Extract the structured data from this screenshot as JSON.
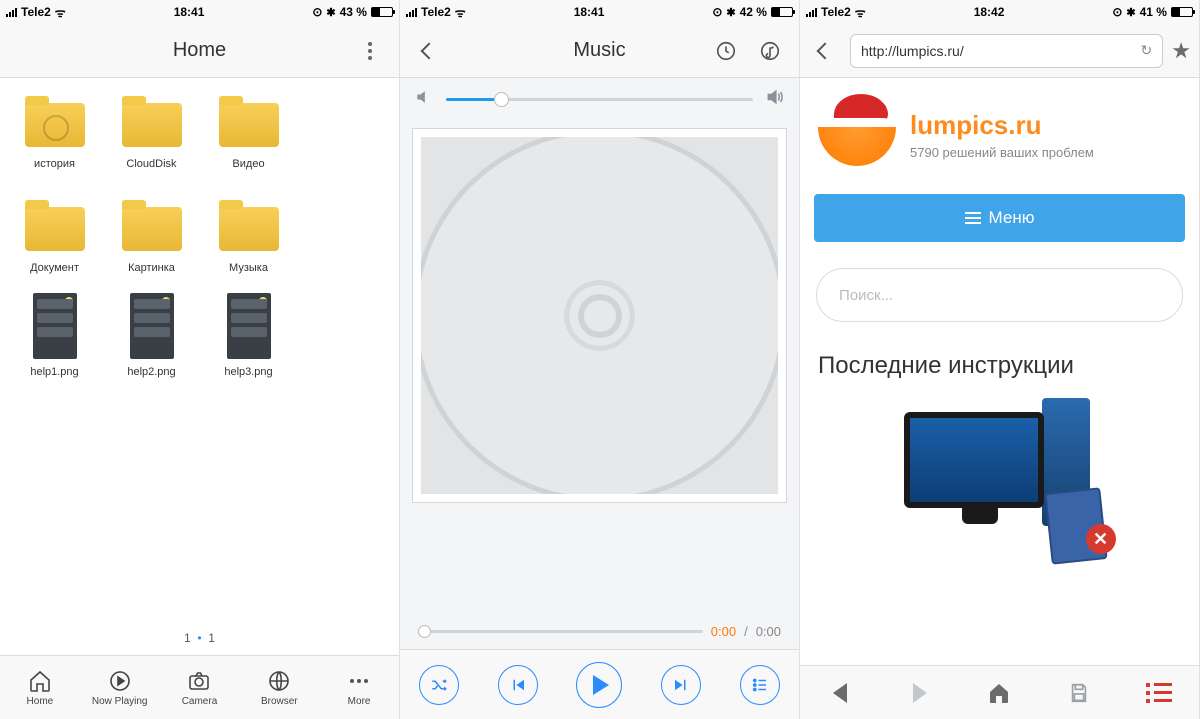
{
  "status": {
    "carrier": "Tele2",
    "s1_time": "18:41",
    "s2_time": "18:41",
    "s3_time": "18:42",
    "s1_batt": "43 %",
    "s2_batt": "42 %",
    "s3_batt": "41 %",
    "alarm_glyph": "⊙",
    "bt_glyph": "✱"
  },
  "screen1": {
    "title": "Home",
    "items": [
      {
        "label": "история",
        "kind": "folder-history"
      },
      {
        "label": "CloudDisk",
        "kind": "folder"
      },
      {
        "label": "Видео",
        "kind": "folder"
      },
      {
        "label": "Документ",
        "kind": "folder"
      },
      {
        "label": "Картинка",
        "kind": "folder"
      },
      {
        "label": "Музыка",
        "kind": "folder"
      },
      {
        "label": "help1.png",
        "kind": "png"
      },
      {
        "label": "help2.png",
        "kind": "png"
      },
      {
        "label": "help3.png",
        "kind": "png"
      }
    ],
    "pager_left": "1",
    "pager_right": "1",
    "tabs": [
      {
        "label": "Home"
      },
      {
        "label": "Now Playing"
      },
      {
        "label": "Camera"
      },
      {
        "label": "Browser"
      },
      {
        "label": "More"
      }
    ]
  },
  "screen2": {
    "title": "Music",
    "time_current": "0:00",
    "time_sep": "/",
    "time_total": "0:00"
  },
  "screen3": {
    "url": "http://lumpics.ru/",
    "site_title": "lumpics.ru",
    "site_sub": "5790 решений ваших проблем",
    "menu_label": "Меню",
    "search_placeholder": "Поиск...",
    "section_heading": "Последние инструкции",
    "err_glyph": "✕"
  }
}
